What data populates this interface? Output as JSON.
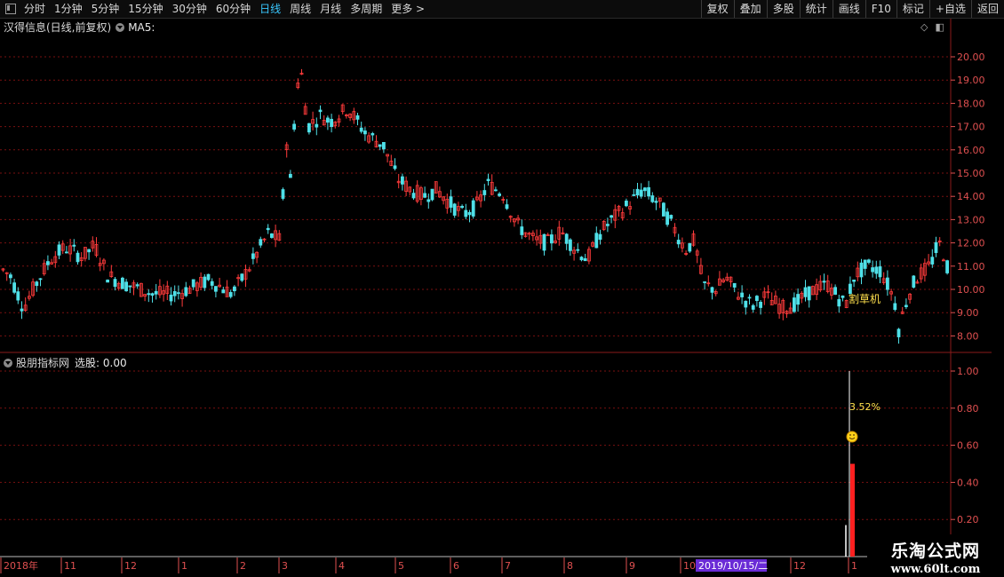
{
  "toolbar": {
    "left_items": [
      "分时",
      "1分钟",
      "5分钟",
      "15分钟",
      "30分钟",
      "60分钟",
      "日线",
      "周线",
      "月线",
      "多周期",
      "更多 >"
    ],
    "active_index": 6,
    "right_items": [
      "复权",
      "叠加",
      "多股",
      "统计",
      "画线",
      "F10",
      "标记",
      "+自选",
      "返回"
    ]
  },
  "main_panel": {
    "title": "汉得信息(日线,前复权)",
    "indicator": "MA5:",
    "annotation": "割草机",
    "y_ticks": [
      "20.00",
      "19.00",
      "18.00",
      "17.00",
      "16.00",
      "15.00",
      "14.00",
      "13.00",
      "12.00",
      "11.00",
      "10.00",
      "9.00",
      "8.00"
    ]
  },
  "sub_panel": {
    "title": "股朋指标网",
    "value_text": "选股: 0.00",
    "annotation": "3.52%",
    "y_ticks": [
      "1.00",
      "0.80",
      "0.60",
      "0.40",
      "0.20"
    ]
  },
  "x_axis": {
    "labels": [
      "2018年",
      "11",
      "12",
      "1",
      "2",
      "3",
      "4",
      "5",
      "6",
      "7",
      "8",
      "9",
      "10",
      "12",
      "1"
    ],
    "cursor_date": "2019/10/15/二"
  },
  "colors": {
    "up": "#ff3b3b",
    "down": "#4fe0e8",
    "grid": "#7a1010",
    "axis_text": "#e05050",
    "highlight": "#6a2bd6"
  },
  "watermark": {
    "title": "乐淘公式网",
    "url": "www.60lt.com"
  }
}
